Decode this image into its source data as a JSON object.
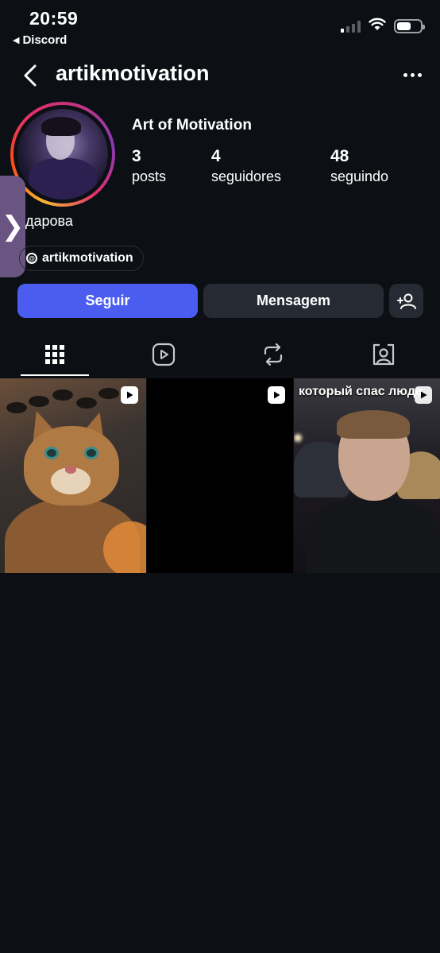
{
  "status_bar": {
    "time": "20:59",
    "back_app": "Discord",
    "back_icon": "triangle-left-icon",
    "signal_bars_active": 1,
    "signal_bars_total": 4,
    "battery_level": 0.6
  },
  "header": {
    "title": "artikmotivation"
  },
  "profile": {
    "display_name": "Art of Motivation",
    "stats": {
      "posts": {
        "value": "3",
        "label": "posts"
      },
      "followers": {
        "value": "4",
        "label": "seguidores"
      },
      "following": {
        "value": "48",
        "label": "seguindo"
      }
    },
    "bio": "дарова",
    "threads_handle": "artikmotivation"
  },
  "side_tab": {
    "glyph": "❯"
  },
  "actions": {
    "follow_label": "Seguir",
    "message_label": "Mensagem"
  },
  "tabs": [
    {
      "name": "posts",
      "icon": "grid-icon",
      "active": true
    },
    {
      "name": "reels",
      "icon": "reels-icon",
      "active": false
    },
    {
      "name": "reposts",
      "icon": "repost-icon",
      "active": false
    },
    {
      "name": "tagged",
      "icon": "tagged-icon",
      "active": false
    }
  ],
  "posts": [
    {
      "type": "reel",
      "description_icon": "cat-video"
    },
    {
      "type": "reel",
      "description_icon": "black-video"
    },
    {
      "type": "reel",
      "caption": "который спас люде"
    }
  ],
  "colors": {
    "background": "#0c0f14",
    "follow_button": "#4a5df0",
    "secondary_button": "#262a33",
    "side_tab": "#6a5582"
  }
}
